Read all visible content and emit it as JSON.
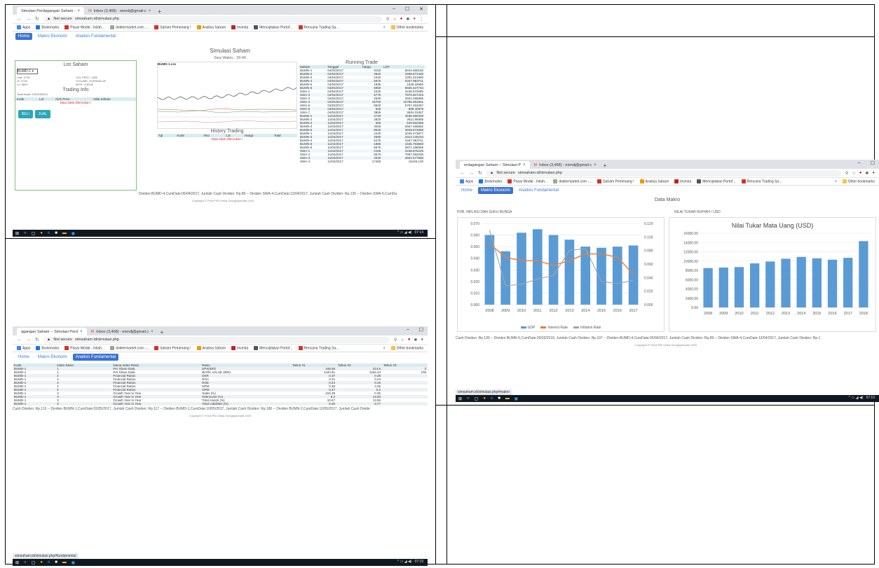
{
  "browser": {
    "tab1": "Simulasi Perdagangan Saham -",
    "tab2": "Inbox (3,468) - eiendj@gmail.c",
    "tab1_alt": "agangan Saham -- Simulasi Perd",
    "tab1_alt2": "erdagangan Saham -- Simulasi P",
    "not_secure": "Not secure",
    "url": "simsaham.id/simulasi.php",
    "bookmarks": [
      "Apps",
      "Bookmarks",
      "Pasar Modal - Inilah...",
      "doktermarket.com -...",
      "Saham Pemenang !",
      "Analisa Saham",
      "Investa",
      "Menciptakan Portof...",
      "Rencana Trading Sa..."
    ],
    "other_bookmarks": "Other bookmarks",
    "more": "»"
  },
  "nav": {
    "home": "Home",
    "makro": "Makro Ekonomi",
    "fundamental": "Analisis Fundamental"
  },
  "s1": {
    "title": "Simulasi Saham",
    "sisa_waktu": "Sisa Waktu : 29:40",
    "list_saham": "List Saham",
    "select_value": "BUMD-1",
    "info": [
      "Last: 3730",
      "VOL PERC: 1850",
      "Hi: 4740",
      "VOLUME: OVERVALUE",
      "Lo: 3820",
      "MOS: -0.8246"
    ],
    "trading_info": "Trading Info",
    "total_asset": "Total Asset: 1000000000",
    "cols": [
      "Kode",
      "Lot",
      "AVG Price",
      "Nilai Saham"
    ],
    "no_data": "Data tidak ditemukan !",
    "beli": "BELI",
    "jual": "JUAL",
    "chart_label": "BUMD-1.csv",
    "history_title": "History Trading",
    "history_cols": [
      "Tgl",
      "Kode",
      "Aksi",
      "Lot",
      "Harga",
      "Total"
    ],
    "running_title": "Running Trade",
    "running_cols": [
      "Saham",
      "Tanggal",
      "Harga",
      "LOT"
    ],
    "running_rows": [
      [
        "BUMN-1",
        "04/04/2017",
        "8150",
        "8044.680156"
      ],
      [
        "BUMN-2",
        "04/04/2017",
        "2840",
        "2598.874336"
      ],
      [
        "BUMN-3",
        "04/04/2017",
        "2340",
        "2301.021890"
      ],
      [
        "BUMN-4",
        "04/04/2017",
        "5875",
        "5347.883711"
      ],
      [
        "BUMN-5",
        "04/04/2017",
        "1835",
        "1548.33956"
      ],
      [
        "BUMN-6",
        "04/04/2017",
        "6050",
        "6836.427734"
      ],
      [
        "SWA-1",
        "04/04/2017",
        "2225",
        "2248.572685"
      ],
      [
        "SWA-2",
        "04/04/2017",
        "6775",
        "7876.607423"
      ],
      [
        "SWA-3",
        "04/04/2017",
        "2530",
        "2504.285886"
      ],
      [
        "SWA-4",
        "04/04/2017",
        "16750",
        "15798.391801"
      ],
      [
        "SWA-5",
        "04/04/2017",
        "8620",
        "5767.263467"
      ],
      [
        "SWA-6",
        "04/04/2017",
        "625",
        "589.40976"
      ],
      [
        "SWA-7",
        "04/04/2017",
        "3955",
        "3691.03457"
      ],
      [
        "BUMN-1",
        "11/04/2017",
        "4740",
        "4538.355330"
      ],
      [
        "BUMN-2",
        "11/04/2017",
        "2820",
        "2611.86898"
      ],
      [
        "BUMN-3",
        "11/04/2017",
        "665",
        "549.662366"
      ],
      [
        "BUMN-4",
        "11/04/2017",
        "3030",
        "2667.465852"
      ],
      [
        "BUMN-5",
        "11/04/2017",
        "8530",
        "3949.574655"
      ],
      [
        "BUMN-1",
        "11/04/2017",
        "2430",
        "2048.473877"
      ],
      [
        "BUMN-3",
        "11/04/2017",
        "2580",
        "2313.140234"
      ],
      [
        "BUMN-4",
        "11/04/2017",
        "5475",
        "5347.883711"
      ],
      [
        "BUMN-5",
        "11/04/2017",
        "1885",
        "1536.783660"
      ],
      [
        "BUMN-6",
        "11/04/2017",
        "6575",
        "6871.188559"
      ],
      [
        "SWA-1",
        "11/04/2017",
        "2155",
        "2228.876245"
      ],
      [
        "SWA-2",
        "11/04/2017",
        "8575",
        "7897.082035"
      ],
      [
        "SWA-3",
        "11/04/2017",
        "3330",
        "3922.677985"
      ],
      [
        "SWA-4",
        "11/04/2017",
        "17450",
        "16446.120"
      ]
    ],
    "ticker": "Dividen:BUMD-4,CumDate:05/04/2017, Jumlah Cash Dividen: Rp.89 -- Dividen SWA-4,CumDate:12/04/2017, Jumlah Cash Dividen: Rp.130 -- Dividen SWA-5,CumDa",
    "copyright": "Copyright © Prodi PBI Unika Soegijapranata 2020",
    "clock": "07:14"
  },
  "s2": {
    "title": "Data Makro",
    "left_title": "PDB, INFLASI DAN SUKU BUNGA",
    "right_title": "NILAI TUKAR RUPIAH / USD",
    "status_url": "simsaham.id/simulasi.php#makro",
    "ticker": "Cash Dividen: Rp.199 -- Dividen BUMN-5,CumDate:29/03/2018, Jumlah Cash Dividen: Rp.107 -- Dividen BUMD-4,CumDate:05/04/2017, Jumlah Cash Dividen: Rp.89 -- Dividen SWA-4,CumDate:12/04/2017, Jumlah Cash Dividen: Rp.1",
    "copyright": "Copyright © Prodi PBI Unika Soegijapranata 2020",
    "clock": "07:19"
  },
  "s3": {
    "cols": [
      "Kode",
      "Index Rasio",
      "Nama Index Rasio",
      "Rasio",
      "Tahun #1",
      "Tahun #2",
      "Tahun #3"
    ],
    "rows": [
      [
        "BUMD-1",
        "1",
        "Per Share Data",
        "EPS(IDR)",
        "349.59",
        "314.6",
        "2"
      ],
      [
        "BUMD-1",
        "1",
        "Per Share Data",
        "BOOK VALUE (IDR)",
        "1420.61",
        "1264.43",
        "108"
      ],
      [
        "BUMD-1",
        "2",
        "Financial Ratios",
        "DER",
        "0.37",
        "0.28",
        ""
      ],
      [
        "BUMD-1",
        "2",
        "Financial Ratios",
        "ROA",
        "0.21",
        "0.23",
        ""
      ],
      [
        "BUMD-1",
        "2",
        "Financial Ratios",
        "ROE",
        "0.24",
        "0.25",
        ""
      ],
      [
        "BUMD-1",
        "2",
        "Financial Ratios",
        "NPM",
        "0.36",
        "0.35",
        ""
      ],
      [
        "BUMD-1",
        "2",
        "Financial Ratios",
        "OPM",
        "0.47",
        "0.2",
        ""
      ],
      [
        "BUMD-1",
        "3",
        "Growth Year to Year",
        "Sales (%)",
        "-153.38",
        "0.35",
        ""
      ],
      [
        "BUMD-1",
        "3",
        "Growth Year to Year",
        "Netincome (%)",
        "9.2",
        "14.93",
        ""
      ],
      [
        "BUMD-1",
        "3",
        "Growth Year to Year",
        "Total Assets (%)",
        "10.67",
        "13.55",
        ""
      ],
      [
        "BUMD-1",
        "3",
        "Growth Year to Year",
        "Total Liabilities (%)",
        "6.49",
        "-3.77",
        ""
      ]
    ],
    "ticker": "Cash Dividen: Rp.113 -- Dividen BUMN-1,CumDate:02/05/2017, Jumlah Cash Dividen: Rp.117 -- Dividen BUMD-1,CumDate:10/05/2017, Jumlah Cash Dividen: Rp.180 -- Dividen BUMN-2,CumDate:12/05/2017, Jumlah Cash Divide",
    "copyright": "Copyright © Prodi PBI Unika Soegijapranata 2020",
    "status_url": "simsaham.id/simulasi.php#fundamental",
    "clock": "07:19"
  },
  "chart_data": [
    {
      "type": "bar",
      "title": "",
      "categories": [
        "2008",
        "2009",
        "2010",
        "2011",
        "2012",
        "2013",
        "2014",
        "2015",
        "2016",
        "2017"
      ],
      "series": [
        {
          "name": "GDP",
          "axis": "left",
          "values": [
            0.06,
            0.046,
            0.062,
            0.065,
            0.06,
            0.056,
            0.05,
            0.049,
            0.05,
            0.051
          ]
        },
        {
          "name": "Interest Rate",
          "axis": "right",
          "type": "line",
          "values": [
            0.09,
            0.07,
            0.065,
            0.065,
            0.058,
            0.065,
            0.075,
            0.075,
            0.07,
            0.045
          ]
        },
        {
          "name": "Inflation Rate",
          "axis": "right",
          "type": "line",
          "values": [
            0.11,
            0.028,
            0.03,
            0.038,
            0.043,
            0.08,
            0.083,
            0.034,
            0.031,
            0.036
          ]
        }
      ],
      "ylim_left": [
        0,
        0.07
      ],
      "ylim_right": [
        0,
        0.12
      ],
      "yticks_left": [
        "0.070",
        "0.060",
        "0.050",
        "0.040",
        "0.030",
        "0.020",
        "0.010",
        "0.000"
      ],
      "yticks_right": [
        "0.120",
        "0.100",
        "0.080",
        "0.060",
        "0.040",
        "0.020",
        "0.000"
      ],
      "colors": {
        "gdp": "#5b9bd5",
        "interest": "#ed7d31",
        "inflation": "#a5a5a5"
      },
      "grid": true,
      "legend": "bottom"
    },
    {
      "type": "bar",
      "title": "Nilai Tukar Mata Uang (USD)",
      "categories": [
        "2008",
        "2009",
        "2010",
        "2011",
        "2012",
        "2013",
        "2014",
        "2015",
        "2016",
        "2017",
        "2018"
      ],
      "values": [
        8500,
        8600,
        8700,
        9500,
        9900,
        10500,
        10900,
        10600,
        10300,
        10700,
        14300
      ],
      "ylim": [
        0,
        16000
      ],
      "yticks": [
        "16000.00",
        "14000.00",
        "12000.00",
        "10000.00",
        "8000.00",
        "6000.00",
        "4000.00",
        "2000.00",
        "0.00"
      ],
      "color": "#5b9bd5",
      "grid": true
    }
  ]
}
